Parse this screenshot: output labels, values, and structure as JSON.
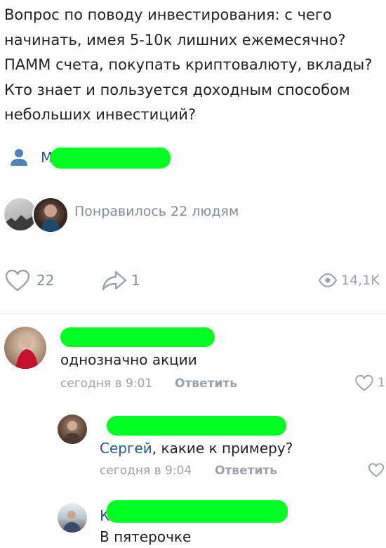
{
  "post": {
    "text": "Вопрос по поводу инвестирования: с чего начинать, имея 5-10к лишних ежемесячно? ПАММ счета, покупать криптовалюту, вклады? Кто знает и пользуется доходным способом небольших инвестиций?",
    "author_initial": "М"
  },
  "likes_summary": "Понравилось 22 людям",
  "actions": {
    "likes": "22",
    "shares": "1",
    "views": "14,1K"
  },
  "comments": [
    {
      "name_initial": "",
      "text": "однозначно акции",
      "time": "сегодня в 9:01",
      "reply_label": "Ответить",
      "likes": "1"
    },
    {
      "name_initial": "",
      "mention": "Сергей",
      "text": ", какие к примеру?",
      "time": "сегодня в 9:04",
      "reply_label": "Ответить",
      "likes": ""
    },
    {
      "name_initial": "К",
      "text": "В пятерочке"
    }
  ],
  "colors": {
    "accent": "#2a5885",
    "secondary_text": "#818c99",
    "icon": "#99a2ad",
    "redaction": "#00ff22"
  }
}
